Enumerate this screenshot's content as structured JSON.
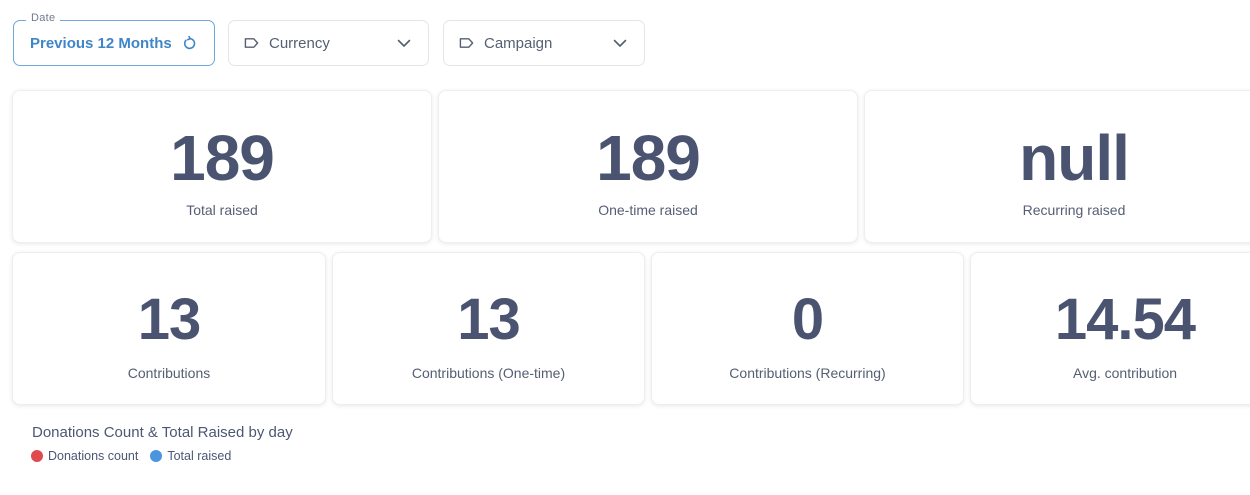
{
  "filters": {
    "date": {
      "legend": "Date",
      "value": "Previous 12 Months",
      "icon": "reset-icon"
    },
    "currency": {
      "label": "Currency",
      "icon": "tag-icon"
    },
    "campaign": {
      "label": "Campaign",
      "icon": "tag-icon"
    }
  },
  "scalars_top": [
    {
      "value": "189",
      "label": "Total raised"
    },
    {
      "value": "189",
      "label": "One-time raised"
    },
    {
      "value": "null",
      "label": "Recurring raised"
    }
  ],
  "scalars_bottom": [
    {
      "value": "13",
      "label": "Contributions"
    },
    {
      "value": "13",
      "label": "Contributions (One-time)"
    },
    {
      "value": "0",
      "label": "Contributions (Recurring)"
    },
    {
      "value": "14.54",
      "label": "Avg. contribution"
    }
  ],
  "chart": {
    "title": "Donations Count & Total Raised by day",
    "legend": [
      {
        "label": "Donations count",
        "color": "#e04a4f"
      },
      {
        "label": "Total raised",
        "color": "#4b94de"
      }
    ]
  },
  "colors": {
    "accent": "#3f86c9",
    "number": "#4a5370"
  }
}
